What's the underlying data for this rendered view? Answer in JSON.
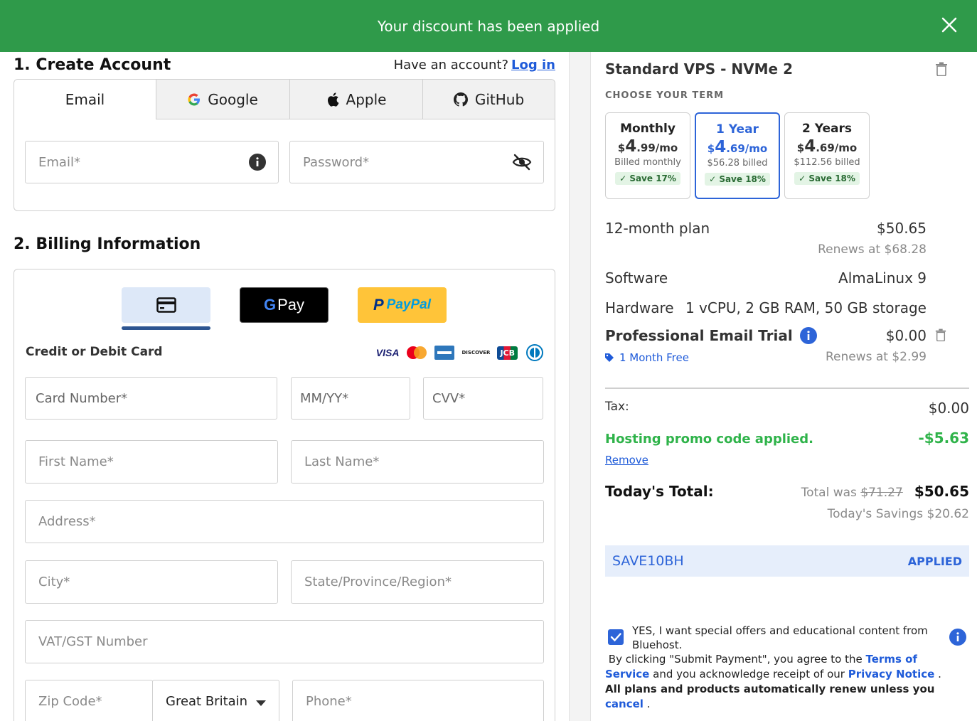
{
  "banner": {
    "message": "Your discount has been applied"
  },
  "account": {
    "heading": "1. Create Account",
    "have_account": "Have an account?",
    "login_label": "Log in",
    "tabs": [
      "Email",
      "Google",
      "Apple",
      "GitHub"
    ],
    "email_placeholder": "Email*",
    "password_placeholder": "Password*"
  },
  "billing": {
    "heading": "2. Billing Information",
    "gpay_label": "Pay",
    "paypal_label": "PayPal",
    "cc_label": "Credit or Debit Card",
    "card_logos": [
      "VISA",
      "DISCOVER",
      "JCB"
    ],
    "fields": {
      "card_number": "Card Number*",
      "expiry": "MM/YY*",
      "cvv": "CVV*",
      "first_name": "First Name*",
      "last_name": "Last Name*",
      "address": "Address*",
      "city": "City*",
      "state": "State/Province/Region*",
      "vat": "VAT/GST Number",
      "zip": "Zip Code*",
      "country": "Great Britain",
      "phone": "Phone*"
    }
  },
  "summary": {
    "plan_title": "Standard VPS - NVMe 2",
    "term_label": "CHOOSE YOUR TERM",
    "terms": [
      {
        "name": "Monthly",
        "dollar": "$",
        "whole": "4",
        "rest": ".99/mo",
        "billed": "Billed monthly",
        "save": "Save 17%"
      },
      {
        "name": "1 Year",
        "dollar": "$",
        "whole": "4",
        "rest": ".69/mo",
        "billed": "$56.28 billed",
        "save": "Save 18%"
      },
      {
        "name": "2 Years",
        "dollar": "$",
        "whole": "4",
        "rest": ".69/mo",
        "billed": "$112.56 billed",
        "save": "Save 18%"
      }
    ],
    "plan_row": {
      "label": "12-month plan",
      "value": "$50.65",
      "renews": "Renews at $68.28"
    },
    "software": {
      "label": "Software",
      "value": "AlmaLinux 9"
    },
    "hardware": {
      "label": "Hardware",
      "value": "1 vCPU, 2 GB RAM, 50 GB storage"
    },
    "email_trial": {
      "label": "Professional Email Trial",
      "value": "$0.00",
      "tag": "1 Month Free",
      "renews": "Renews at $2.99"
    },
    "tax": {
      "label": "Tax:",
      "value": "$0.00"
    },
    "promo": {
      "label": "Hosting promo code applied.",
      "value": "-$5.63",
      "remove": "Remove"
    },
    "total": {
      "label": "Today's Total:",
      "was_label": "Total was",
      "was_value": "$71.27",
      "value": "$50.65",
      "savings": "Today's Savings $20.62"
    },
    "coupon": {
      "code": "SAVE10BH",
      "status": "APPLIED"
    },
    "offers_text": "YES, I want special offers and educational content from Bluehost.",
    "legal": {
      "p1": "By clicking \"Submit Payment\", you agree to the",
      "tos": "Terms of Service",
      "p2": "and you acknowledge receipt of our",
      "privacy": "Privacy Notice",
      "p3": ".",
      "bold": "All plans and products automatically renew unless you",
      "cancel": "cancel",
      "p4": "."
    }
  },
  "colors": {
    "banner": "#2f9a4a",
    "accent": "#2d64d8",
    "promo": "#2fb34a"
  }
}
